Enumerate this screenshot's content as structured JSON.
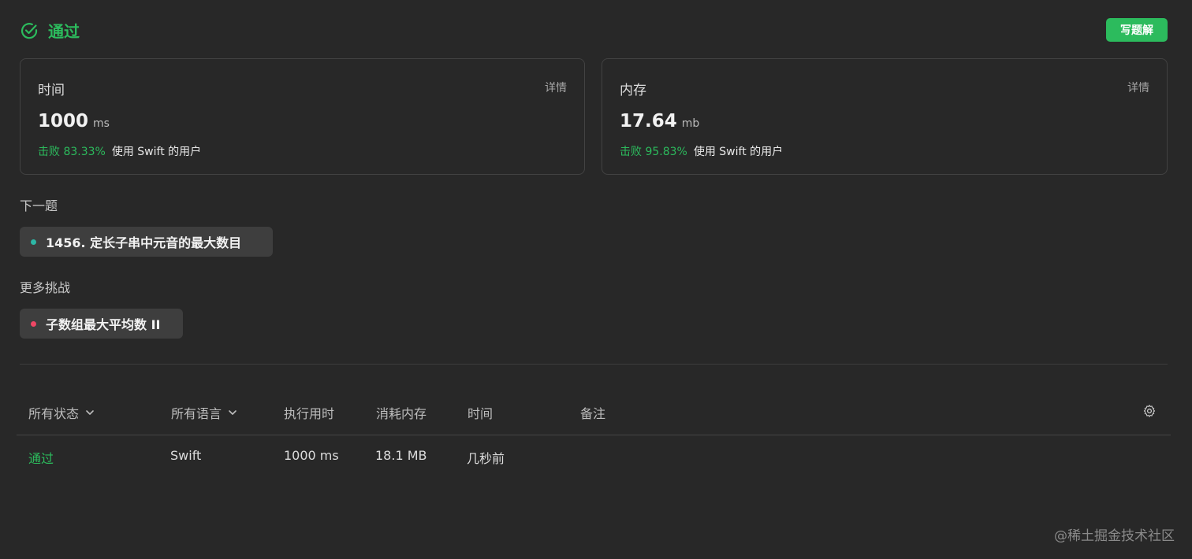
{
  "result": {
    "status": "通过",
    "write_solution_label": "写题解"
  },
  "colors": {
    "accent_green": "#2cbb5d",
    "next_dot": "#2db7a6",
    "more_dot": "#ef4765"
  },
  "stats": [
    {
      "label": "时间",
      "detail": "详情",
      "value": "1000",
      "unit": "ms",
      "beat": "击败 83.33%",
      "beat_suffix": "使用 Swift 的用户"
    },
    {
      "label": "内存",
      "detail": "详情",
      "value": "17.64",
      "unit": "mb",
      "beat": "击败 95.83%",
      "beat_suffix": "使用 Swift 的用户"
    }
  ],
  "next": {
    "title": "下一题",
    "problem": "1456. 定长子串中元音的最大数目"
  },
  "more": {
    "title": "更多挑战",
    "problem": "子数组最大平均数 II"
  },
  "table": {
    "headers": {
      "status": "所有状态",
      "language": "所有语言",
      "runtime": "执行用时",
      "memory": "消耗内存",
      "time": "时间",
      "note": "备注"
    },
    "rows": [
      {
        "status": "通过",
        "language": "Swift",
        "runtime": "1000 ms",
        "memory": "18.1 MB",
        "time": "几秒前",
        "note": ""
      }
    ]
  },
  "watermark": "@稀土掘金技术社区"
}
